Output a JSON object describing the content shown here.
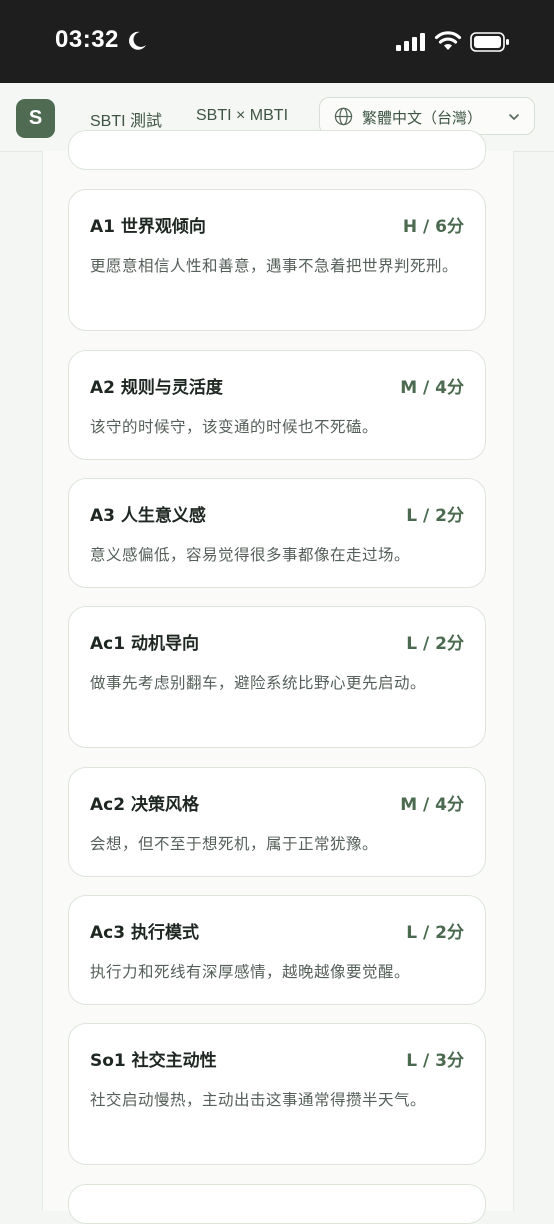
{
  "status_bar": {
    "time": "03:32",
    "icons": [
      "moon-icon",
      "signal-icon",
      "wifi-icon",
      "battery-icon"
    ]
  },
  "nav": {
    "logo": "S",
    "links": [
      "SBTI 測試",
      "SBTI × MBTI"
    ],
    "language": "繁體中文（台灣）",
    "icons": [
      "globe-icon",
      "chevron-down-icon"
    ]
  },
  "colors": {
    "accent": "#4f6b52",
    "score": "#4b6a4f",
    "background": "#f4f6f3"
  },
  "cards": [
    {
      "title": "A1 世界观倾向",
      "score": "H / 6分",
      "desc": "更愿意相信人性和善意，遇事不急着把世界判死刑。"
    },
    {
      "title": "A2 规则与灵活度",
      "score": "M / 4分",
      "desc": "该守的时候守，该变通的时候也不死磕。"
    },
    {
      "title": "A3 人生意义感",
      "score": "L / 2分",
      "desc": "意义感偏低，容易觉得很多事都像在走过场。"
    },
    {
      "title": "Ac1 动机导向",
      "score": "L / 2分",
      "desc": "做事先考虑别翻车，避险系统比野心更先启动。"
    },
    {
      "title": "Ac2 决策风格",
      "score": "M / 4分",
      "desc": "会想，但不至于想死机，属于正常犹豫。"
    },
    {
      "title": "Ac3 执行模式",
      "score": "L / 2分",
      "desc": "执行力和死线有深厚感情，越晚越像要觉醒。"
    },
    {
      "title": "So1 社交主动性",
      "score": "L / 3分",
      "desc": "社交启动慢热，主动出击这事通常得攒半天气。"
    }
  ]
}
